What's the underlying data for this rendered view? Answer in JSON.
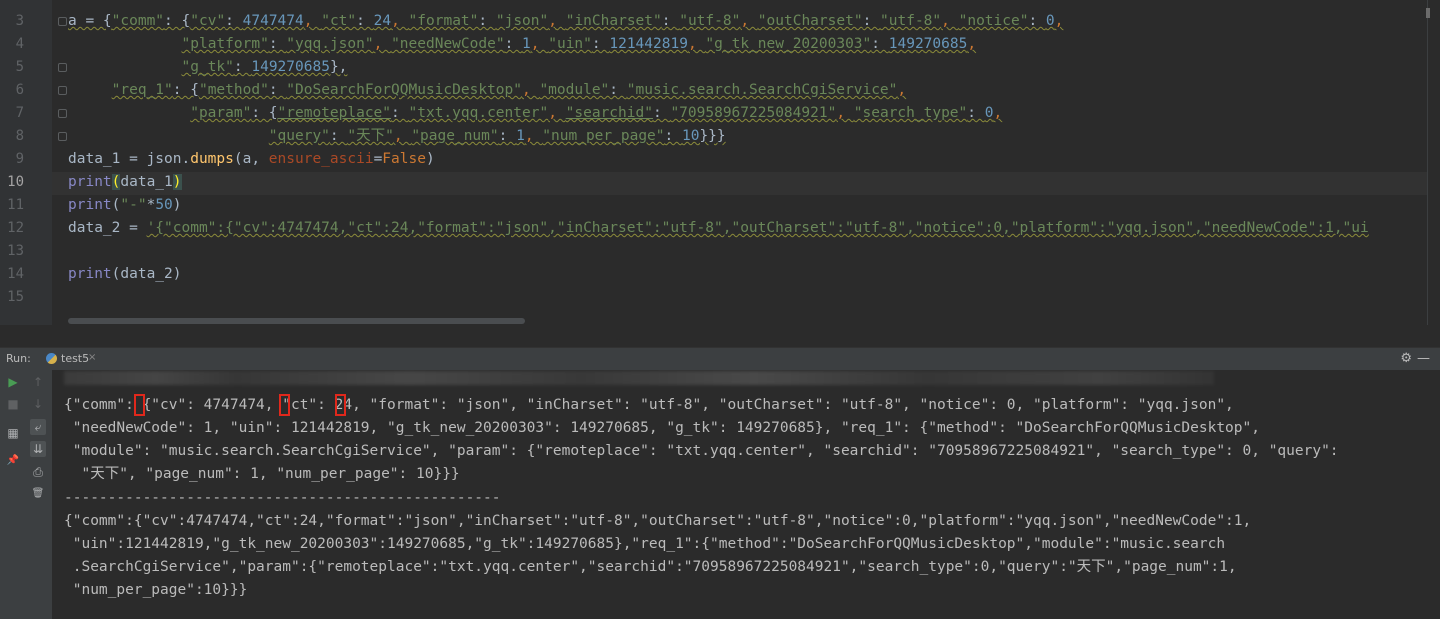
{
  "editor": {
    "line_numbers": [
      "3",
      "4",
      "5",
      "6",
      "7",
      "8",
      "9",
      "10",
      "11",
      "12",
      "13",
      "14",
      "15"
    ],
    "current_line": "10"
  },
  "code": {
    "l3": {
      "a1": "a = {",
      "a2": "\"comm\"",
      "a3": ": {",
      "a4": "\"cv\"",
      "a5": ": ",
      "a6": "4747474",
      "a7": ", ",
      "a8": "\"ct\"",
      "a9": ": ",
      "a10": "24",
      "a11": ", ",
      "a12": "\"format\"",
      "a13": ": ",
      "a14": "\"json\"",
      "a15": ", ",
      "a16": "\"inCharset\"",
      "a17": ": ",
      "a18": "\"utf-8\"",
      "a19": ", ",
      "a20": "\"outCharset\"",
      "a21": ": ",
      "a22": "\"utf-8\"",
      "a23": ", ",
      "a24": "\"notice\"",
      "a25": ": ",
      "a26": "0",
      "a27": ","
    },
    "l4": {
      "a1": "             ",
      "a2": "\"platform\"",
      "a3": ": ",
      "a4": "\"yqq.json\"",
      "a5": ", ",
      "a6": "\"needNewCode\"",
      "a7": ": ",
      "a8": "1",
      "a9": ", ",
      "a10": "\"uin\"",
      "a11": ": ",
      "a12": "121442819",
      "a13": ", ",
      "a14": "\"g_tk_new_20200303\"",
      "a15": ": ",
      "a16": "149270685",
      "a17": ","
    },
    "l5": {
      "a1": "             ",
      "a2": "\"g_tk\"",
      "a3": ": ",
      "a4": "149270685",
      "a5": "},"
    },
    "l6": {
      "a1": "     ",
      "a2": "\"req_1\"",
      "a3": ": {",
      "a4": "\"method\"",
      "a5": ": ",
      "a6": "\"DoSearchForQQMusicDesktop\"",
      "a7": ", ",
      "a8": "\"module\"",
      "a9": ": ",
      "a10": "\"music.search.SearchCgiService\"",
      "a11": ","
    },
    "l7": {
      "a1": "              ",
      "a2": "\"param\"",
      "a3": ": {",
      "a4": "\"remoteplace\"",
      "a5": ": ",
      "a6": "\"txt.yqq.center\"",
      "a7": ", ",
      "a8": "\"searchid\"",
      "a9": ": ",
      "a10": "\"70958967225084921\"",
      "a11": ", ",
      "a12": "\"search_type\"",
      "a13": ": ",
      "a14": "0",
      "a15": ","
    },
    "l8": {
      "a1": "                       ",
      "a2": "\"query\"",
      "a3": ": ",
      "a4": "\"天下\"",
      "a5": ", ",
      "a6": "\"page_num\"",
      "a7": ": ",
      "a8": "1",
      "a9": ", ",
      "a10": "\"num_per_page\"",
      "a11": ": ",
      "a12": "10",
      "a13": "}}}"
    },
    "l9": {
      "a1": "data_1 = json.",
      "a2": "dumps",
      "a3": "(a, ",
      "a4": "ensure_ascii",
      "a5": "=",
      "a6": "False",
      "a7": ")"
    },
    "l10": {
      "a1": "print",
      "a2": "(",
      "a3": "data_1",
      "a4": ")"
    },
    "l11": {
      "a1": "print",
      "a2": "(",
      "a3": "\"-\"",
      "a4": "*",
      "a5": "50",
      "a6": ")"
    },
    "l12": {
      "a1": "data_2 = ",
      "a2": "'{\"comm\":{\"cv\":4747474,\"ct\":24,\"format\":\"json\",\"inCharset\":\"utf-8\",\"outCharset\":\"utf-8\",\"notice\":0,\"platform\":\"yqq.json\",\"needNewCode\":1,\"ui"
    },
    "l14": {
      "a1": "print",
      "a2": "(data_2)"
    }
  },
  "run_panel": {
    "label": "Run:",
    "tab_name": "test5",
    "tab_close": "×",
    "settings_icon": "⚙",
    "minimize_icon": "—"
  },
  "toolbar": {
    "rerun": "▶",
    "up": "↑",
    "stop": "■",
    "down": "↓",
    "layout": "▦",
    "wrap": "⤶",
    "scroll_end": "⇊",
    "pin": "📌",
    "print": "⎙",
    "trash": "🗑"
  },
  "console": {
    "lines": [
      "{\"comm\": {\"cv\": 4747474, \"ct\": 24, \"format\": \"json\", \"inCharset\": \"utf-8\", \"outCharset\": \"utf-8\", \"notice\": 0, \"platform\": \"yqq.json\",",
      " \"needNewCode\": 1, \"uin\": 121442819, \"g_tk_new_20200303\": 149270685, \"g_tk\": 149270685}, \"req_1\": {\"method\": \"DoSearchForQQMusicDesktop\",",
      " \"module\": \"music.search.SearchCgiService\", \"param\": {\"remoteplace\": \"txt.yqq.center\", \"searchid\": \"70958967225084921\", \"search_type\": 0, \"query\":",
      "  \"天下\", \"page_num\": 1, \"num_per_page\": 10}}}",
      "--------------------------------------------------",
      "{\"comm\":{\"cv\":4747474,\"ct\":24,\"format\":\"json\",\"inCharset\":\"utf-8\",\"outCharset\":\"utf-8\",\"notice\":0,\"platform\":\"yqq.json\",\"needNewCode\":1,",
      " \"uin\":121442819,\"g_tk_new_20200303\":149270685,\"g_tk\":149270685},\"req_1\":{\"method\":\"DoSearchForQQMusicDesktop\",\"module\":\"music.search",
      " .SearchCgiService\",\"param\":{\"remoteplace\":\"txt.yqq.center\",\"searchid\":\"70958967225084921\",\"search_type\":0,\"query\":\"天下\",\"page_num\":1,",
      " \"num_per_page\":10}}}"
    ]
  }
}
